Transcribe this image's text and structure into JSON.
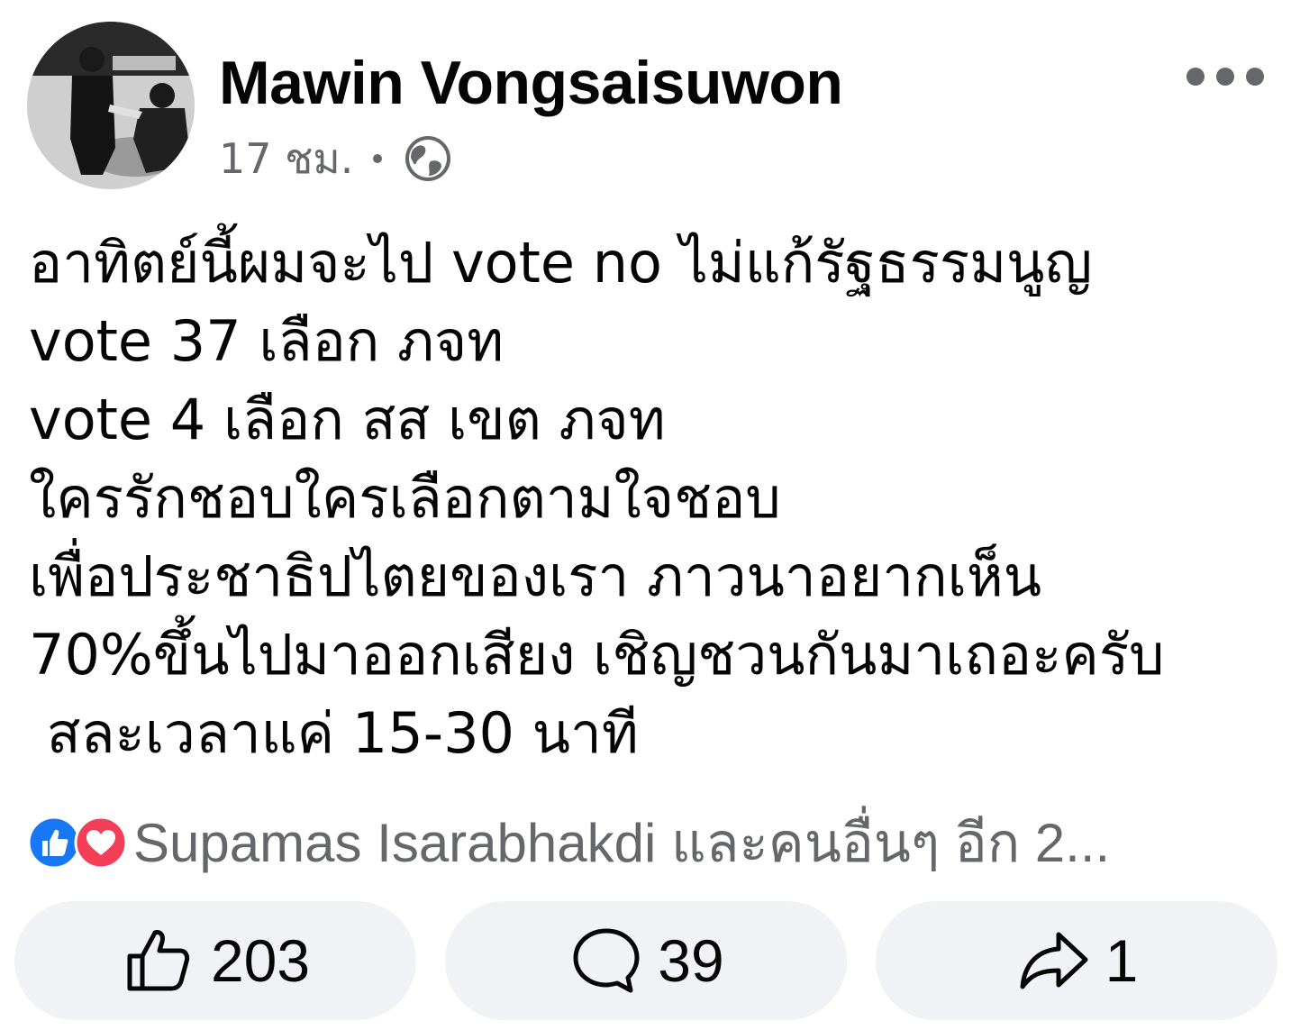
{
  "post": {
    "author": "Mawin Vongsaisuwon",
    "time": "17 ชม.",
    "privacy_icon": "globe-icon",
    "more_icon": "more-options-icon",
    "lines": [
      "อาทิตย์นี้ผมจะไป vote no ไม่แก้รัฐธรรมนูญ",
      "vote 37 เลือก ภจท",
      "vote 4 เลือก สส เขต ภจท",
      "ใครรักชอบใครเลือกตามใจชอบ",
      "เพื่อประชาธิปไตยของเรา ภาวนาอยากเห็น",
      "70%ขึ้นไปมาออกเสียง เชิญชวนกันมาเถอะครับ",
      " สละเวลาแค่ 15-30 นาที"
    ]
  },
  "reactions": {
    "icons": [
      "like-reaction-icon",
      "love-reaction-icon"
    ],
    "summary": "Supamas Isarabhakdi และคนอื่นๆ อีก 2..."
  },
  "actions": {
    "like_count": "203",
    "comment_count": "39",
    "share_count": "1"
  },
  "colors": {
    "text": "#050505",
    "secondary_text": "#65676b",
    "button_bg": "#f0f2f5",
    "like_blue": "#1877f2",
    "love_red": "#f33e58"
  }
}
